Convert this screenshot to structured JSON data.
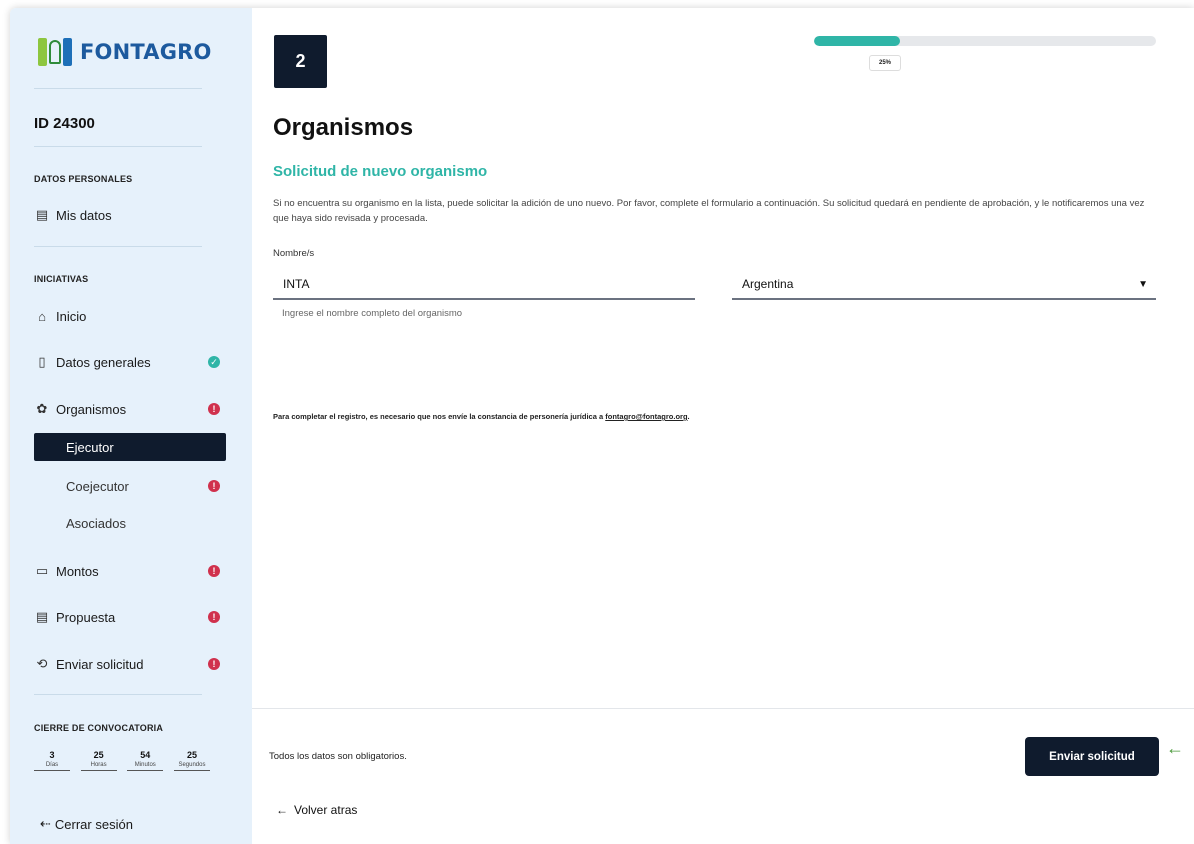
{
  "brand": {
    "name": "FONTAGRO"
  },
  "sidebar": {
    "id_label": "ID 24300",
    "section_personal": "DATOS PERSONALES",
    "mis_datos": "Mis datos",
    "section_iniciativas": "INICIATIVAS",
    "items": {
      "inicio": "Inicio",
      "datos_generales": "Datos generales",
      "organismos": "Organismos",
      "ejecutor": "Ejecutor",
      "coejecutor": "Coejecutor",
      "asociados": "Asociados",
      "montos": "Montos",
      "propuesta": "Propuesta",
      "enviar_solicitud": "Enviar solicitud"
    },
    "badges": {
      "ok": "✓",
      "err": "!"
    },
    "section_cierre": "CIERRE DE CONVOCATORIA",
    "countdown": [
      {
        "value": "3",
        "label": "Días"
      },
      {
        "value": "25",
        "label": "Horas"
      },
      {
        "value": "54",
        "label": "Minutos"
      },
      {
        "value": "25",
        "label": "Segundos"
      }
    ],
    "logout": "Cerrar sesión"
  },
  "header": {
    "step": "2",
    "progress_percent": 25,
    "progress_label": "25%"
  },
  "main": {
    "title": "Organismos",
    "section_title": "Solicitud de nuevo organismo",
    "description": "Si no encuentra su organismo en la lista, puede solicitar la adición de uno nuevo. Por favor, complete el formulario a continuación. Su solicitud quedará en pendiente de aprobación, y le notificaremos una vez que haya sido revisada y procesada.",
    "field_label": "Nombre/s",
    "name_value": "INTA",
    "name_helper": "Ingrese el nombre completo del organismo",
    "country_value": "Argentina",
    "note_prefix": "Para completar el registro, es necesario que nos envíe la constancia de personería jurídica a ",
    "note_email": "fontagro@fontagro.org",
    "note_suffix": "."
  },
  "footer": {
    "required_note": "Todos los datos son obligatorios.",
    "submit_label": "Enviar solicitud",
    "back_label": "Volver atras"
  },
  "colors": {
    "accent": "#2fb5a7",
    "dark": "#0f1b2d",
    "error": "#d0314d",
    "sidebar_bg": "#e6f1fb"
  }
}
